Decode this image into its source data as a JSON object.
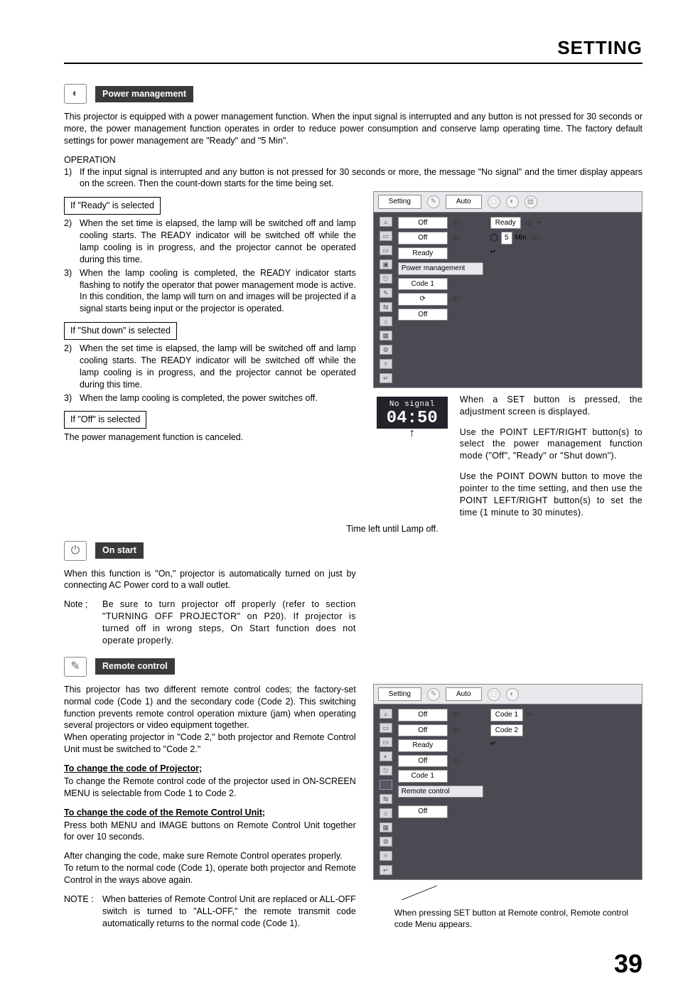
{
  "header": {
    "title": "SETTING"
  },
  "pm": {
    "label": "Power management",
    "intro": "This projector is equipped with a power management function. When the input signal is interrupted and any button is not pressed for 30 seconds or more, the power management function operates in order to reduce power consumption and conserve lamp operating time. The factory default settings for power management are \"Ready\" and \"5 Min\".",
    "op_title": "OPERATION",
    "op1": "If the input signal is interrupted and any button is not pressed for 30 seconds or more, the message \"No signal\" and the timer display appears on the screen. Then the count-down starts for the time being set.",
    "ready_sel": "If \"Ready\" is selected",
    "ready2": "When the set time is elapsed, the lamp will be switched off and lamp cooling starts. The READY indicator will be switched off while the lamp cooling is in progress, and the projector cannot be operated during this time.",
    "ready3": "When the lamp cooling is completed, the READY indicator starts flashing to notify the operator that power management mode is active. In this condition, the lamp will turn on and images will be projected if a signal starts being input or the projector is operated.",
    "shut_sel": "If \"Shut down\" is selected",
    "shut2": "When the set time is elapsed, the lamp will be switched off and lamp cooling starts. The READY indicator will be switched off while the lamp cooling is in progress, and the projector cannot be operated during this time.",
    "shut3": "When the lamp cooling is completed, the power switches off.",
    "off_sel": "If \"Off\" is selected",
    "off_text": "The power management function is canceled."
  },
  "osd1": {
    "tab1": "Setting",
    "tab2": "Auto",
    "rows": {
      "r1": "Off",
      "r2": "Off",
      "r3": "Ready",
      "r4": "Power management",
      "r5": "Code 1",
      "r7": "Off"
    },
    "right": {
      "ready": "Ready",
      "num": "5",
      "min": "Min"
    }
  },
  "notes1": {
    "p1": "When a SET button is pressed, the adjustment screen is displayed.",
    "p2": "Use the POINT LEFT/RIGHT button(s) to select the power management function mode (\"Off\", \"Ready\" or \"Shut down\").",
    "p3": "Use the POINT DOWN button to move the pointer to the time setting, and then use the POINT LEFT/RIGHT button(s) to set the time (1 minute to 30 minutes)."
  },
  "nosig": {
    "label": "No signal",
    "time": "04:50",
    "caption": "Time left until Lamp off."
  },
  "onstart": {
    "label": "On start",
    "p1": "When this function is \"On,\" projector is automatically turned on just by connecting AC Power cord to a wall outlet.",
    "note_lbl": "Note ;",
    "note": "Be sure to turn projector off properly (refer to section \"TURNING OFF PROJECTOR\" on P20).  If projector is turned off in wrong steps, On Start function does not operate properly."
  },
  "rc": {
    "label": "Remote control",
    "p1": "This projector has two different remote control codes; the factory-set normal code (Code 1) and the secondary code (Code 2).  This switching function prevents remote control operation mixture (jam) when operating several projectors or video equipment together.",
    "p1b": "When operating projector in \"Code 2,\"  both projector and Remote Control Unit must be switched to \"Code 2.\"",
    "h1": "To change the code of Projector;",
    "p2": "To change the Remote control code of the projector used in ON-SCREEN MENU is selectable from Code 1 to Code 2.",
    "h2": "To change the code of the Remote Control Unit;",
    "p3": "Press both MENU and IMAGE buttons on Remote Control Unit together for over 10 seconds.",
    "p4": "After changing the code, make sure Remote Control operates properly.",
    "p4b": "To return to the normal code (Code 1), operate both projector and Remote Control in the ways above again.",
    "note_lbl": "NOTE :",
    "note": "When batteries of Remote Control Unit are replaced or ALL-OFF switch is turned to \"ALL-OFF,\" the remote transmit code automatically returns to the normal code (Code 1)."
  },
  "osd2": {
    "tab1": "Setting",
    "tab2": "Auto",
    "rows": {
      "r1": "Off",
      "r2": "Off",
      "r3": "Ready",
      "r4": "Off",
      "r5": "Code 1",
      "r6": "Remote control",
      "r8": "Off"
    },
    "right": {
      "c1": "Code 1",
      "c2": "Code 2"
    },
    "caption": "When pressing SET button at Remote control, Remote control code Menu appears."
  },
  "page": "39"
}
